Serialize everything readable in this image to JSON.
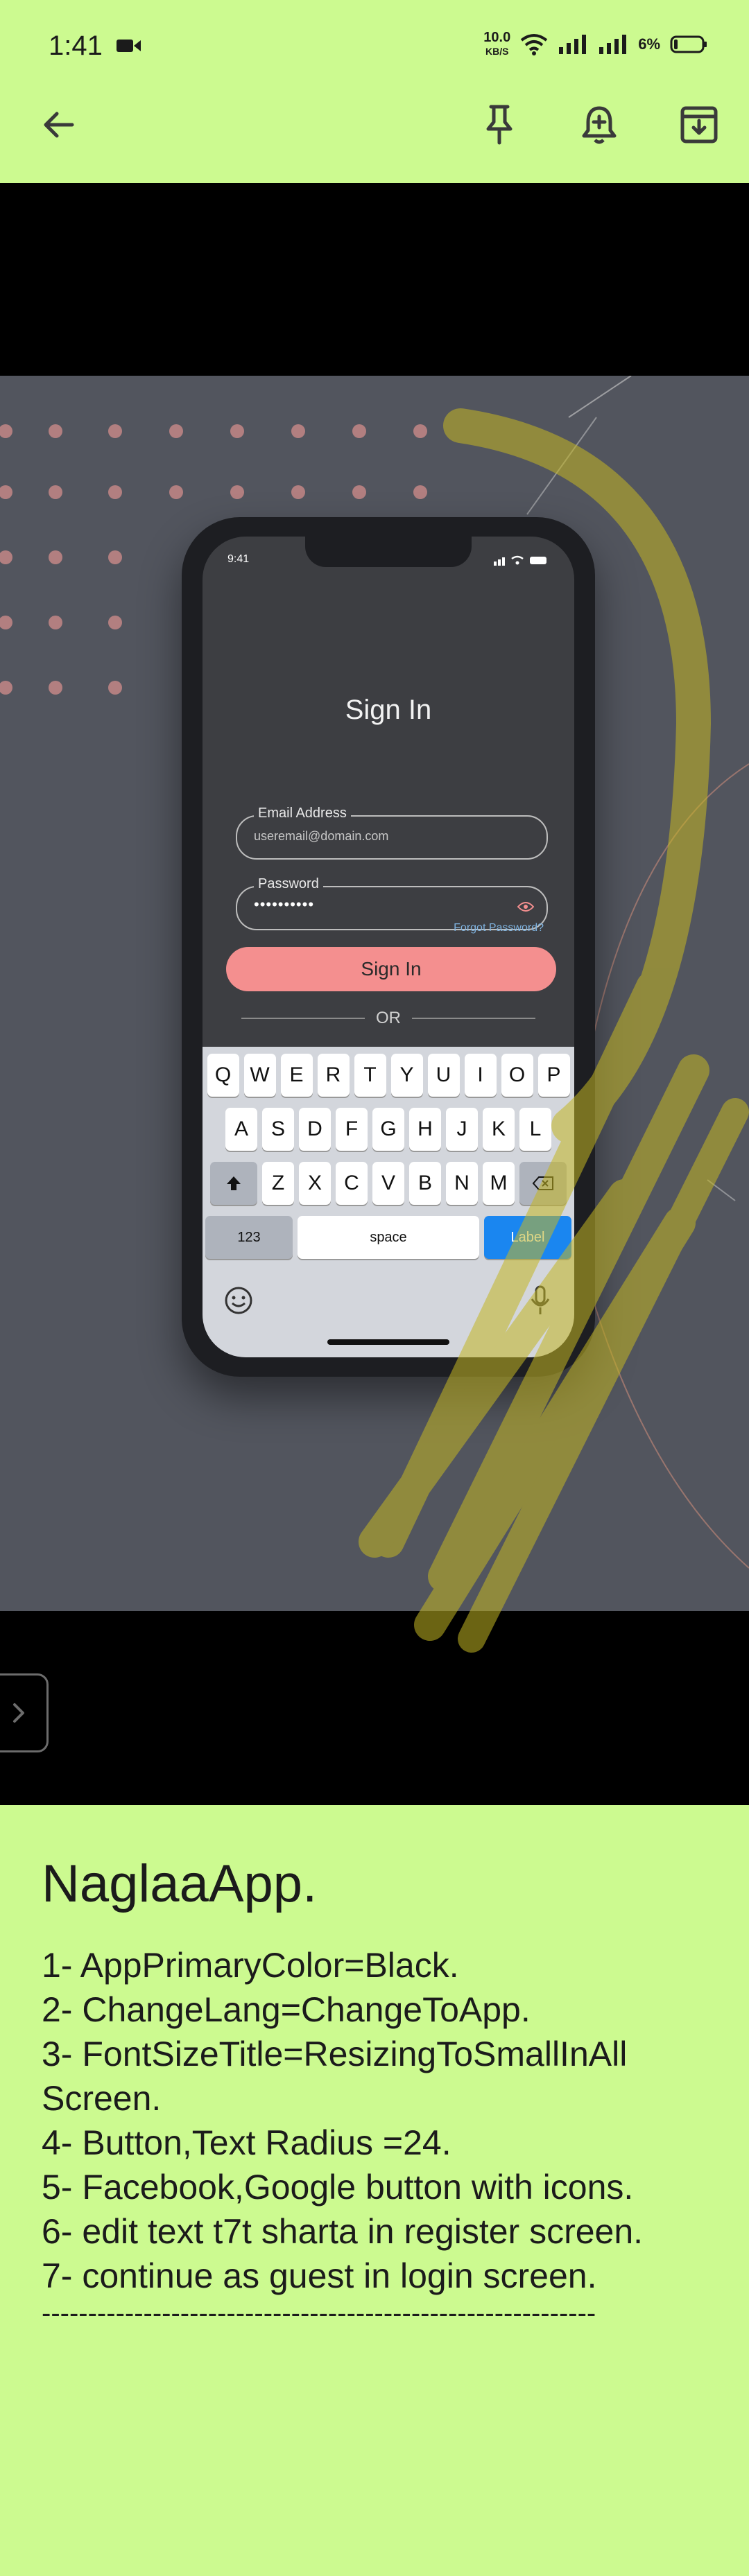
{
  "status_bar": {
    "time": "1:41",
    "speed_value": "10.0",
    "speed_unit": "KB/S",
    "battery": "6%"
  },
  "app_bar": {
    "icons": [
      "back-arrow-icon",
      "pin-icon",
      "reminder-icon",
      "archive-icon"
    ]
  },
  "image": {
    "phone": {
      "time": "9:41",
      "title": "Sign In",
      "email_label": "Email Address",
      "email_value": "useremail@domain.com",
      "password_label": "Password",
      "password_value": "••••••••••",
      "forgot": "Forgot Password?",
      "signin_button": "Sign In",
      "or_text": "OR",
      "keyboard": {
        "row1": [
          "Q",
          "W",
          "E",
          "R",
          "T",
          "Y",
          "U",
          "I",
          "O",
          "P"
        ],
        "row2": [
          "A",
          "S",
          "D",
          "F",
          "G",
          "H",
          "J",
          "K",
          "L"
        ],
        "row3": [
          "Z",
          "X",
          "C",
          "V",
          "B",
          "N",
          "M"
        ],
        "num_key": "123",
        "space_key": "space",
        "action_key": "Label"
      }
    }
  },
  "note": {
    "title": "NaglaaApp.",
    "lines": [
      "1- AppPrimaryColor=Black.",
      "2- ChangeLang=ChangeToApp.",
      "3- FontSizeTitle=ResizingToSmallInAll Screen.",
      "4- Button,Text Radius =24.",
      "5- Facebook,Google button with icons.",
      "6- edit text t7t sharta in register screen.",
      "7- continue as guest in login screen."
    ],
    "separator": "------------------------------------------------------------"
  },
  "colors": {
    "background": "#ccfa90",
    "photo_bg": "#52555e",
    "signin_button": "#f48f8f",
    "keyboard_action": "#1a86f0"
  }
}
